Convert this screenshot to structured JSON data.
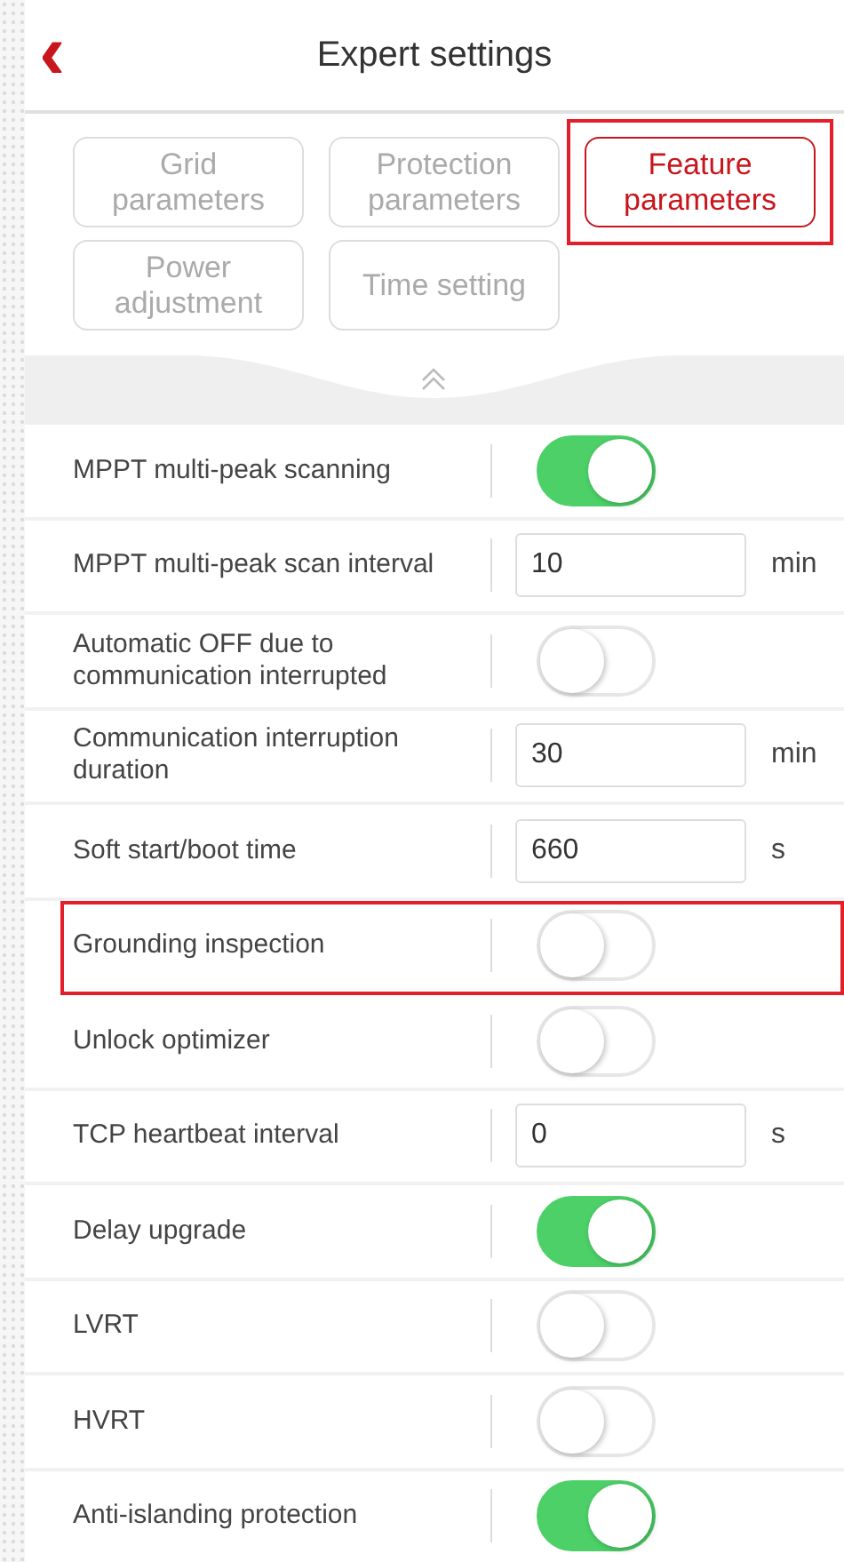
{
  "header": {
    "back": "‹",
    "title": "Expert settings"
  },
  "tabs": [
    {
      "label": "Grid parameters",
      "selected": false,
      "highlighted": false
    },
    {
      "label": "Protection parameters",
      "selected": false,
      "highlighted": false
    },
    {
      "label": "Feature parameters",
      "selected": true,
      "highlighted": true
    },
    {
      "label": "Power adjustment",
      "selected": false,
      "highlighted": false
    },
    {
      "label": "Time setting",
      "selected": false,
      "highlighted": false
    }
  ],
  "settings": [
    {
      "kind": "toggle",
      "label": "MPPT multi-peak scanning",
      "on": true,
      "highlighted": false
    },
    {
      "kind": "input",
      "label": "MPPT multi-peak scan interval",
      "value": "10",
      "unit": "min",
      "highlighted": false
    },
    {
      "kind": "toggle",
      "label": "Automatic OFF due to communication interrupted",
      "on": false,
      "highlighted": false
    },
    {
      "kind": "input",
      "label": "Communication interruption duration",
      "value": "30",
      "unit": "min",
      "highlighted": false
    },
    {
      "kind": "input",
      "label": "Soft start/boot time",
      "value": "660",
      "unit": "s",
      "highlighted": false
    },
    {
      "kind": "toggle",
      "label": "Grounding inspection",
      "on": false,
      "highlighted": true
    },
    {
      "kind": "toggle",
      "label": "Unlock optimizer",
      "on": false,
      "highlighted": false
    },
    {
      "kind": "input",
      "label": "TCP heartbeat interval",
      "value": "0",
      "unit": "s",
      "highlighted": false
    },
    {
      "kind": "toggle",
      "label": "Delay upgrade",
      "on": true,
      "highlighted": false
    },
    {
      "kind": "toggle",
      "label": "LVRT",
      "on": false,
      "highlighted": false
    },
    {
      "kind": "toggle",
      "label": "HVRT",
      "on": false,
      "highlighted": false
    },
    {
      "kind": "toggle",
      "label": "Anti-islanding protection",
      "on": true,
      "highlighted": false
    }
  ]
}
